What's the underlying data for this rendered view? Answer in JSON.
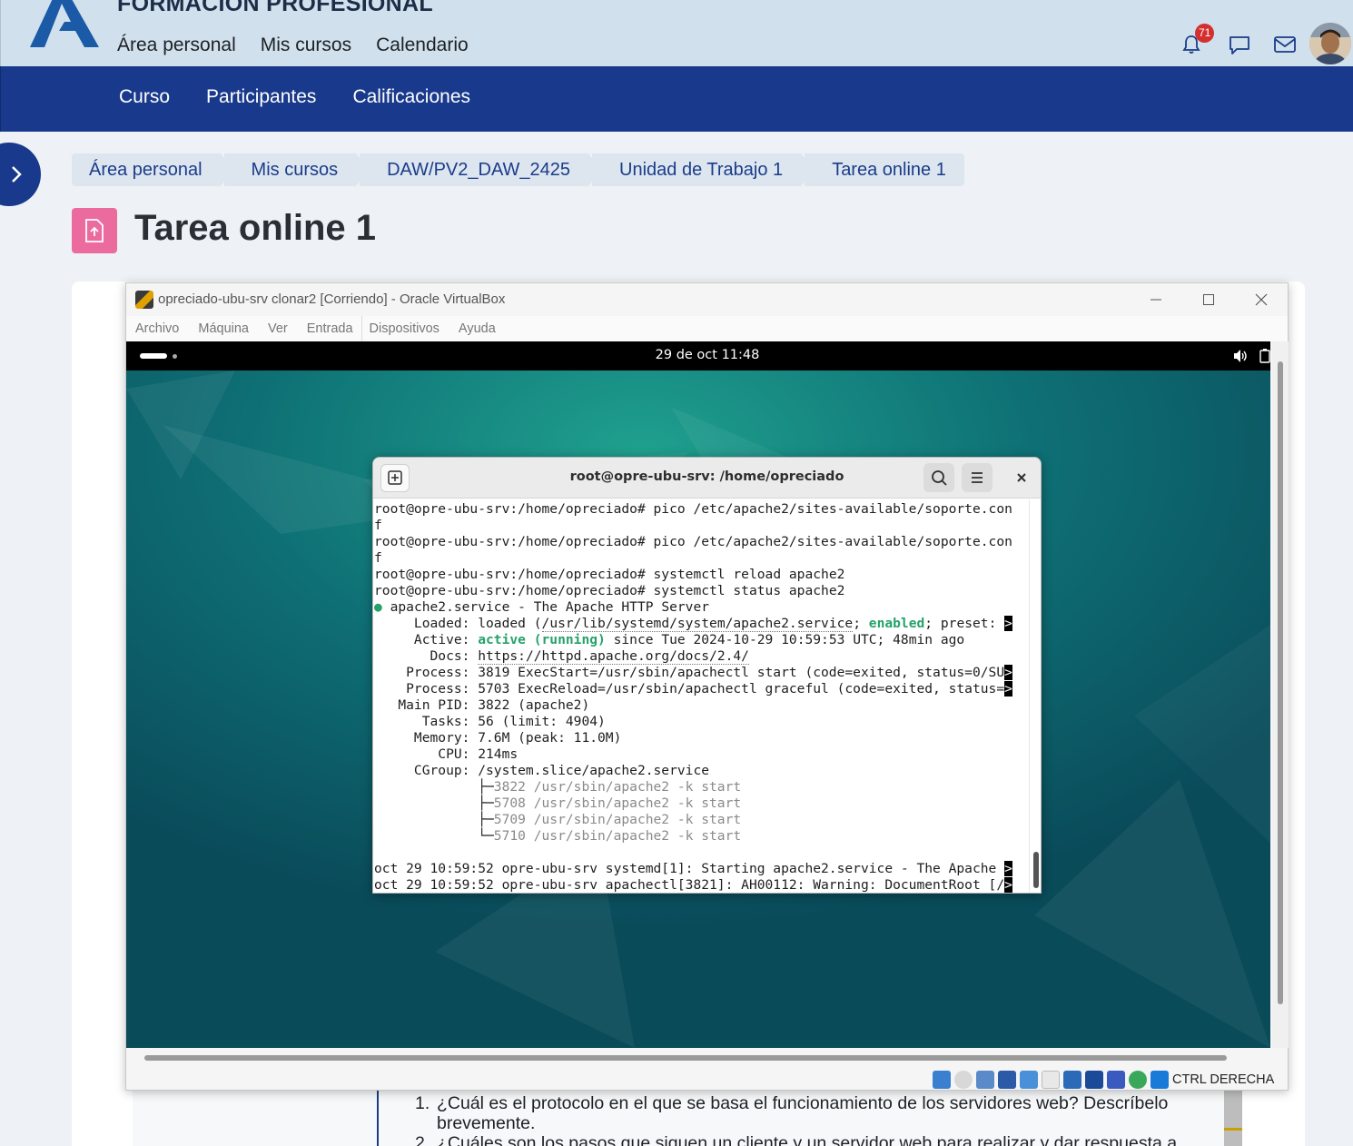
{
  "brand": {
    "name": "FORMACIÓN PROFESIONAL"
  },
  "primary_nav": [
    "Área personal",
    "Mis cursos",
    "Calendario"
  ],
  "notifications": {
    "count": "71"
  },
  "secondary_nav": [
    "Curso",
    "Participantes",
    "Calificaciones"
  ],
  "breadcrumb": [
    "Área personal",
    "Mis cursos",
    "DAW/PV2_DAW_2425",
    "Unidad de Trabajo 1",
    "Tarea online 1"
  ],
  "page": {
    "title": "Tarea online 1"
  },
  "vbox": {
    "title": "opreciado-ubu-srv clonar2 [Corriendo] - Oracle VirtualBox",
    "menu": [
      "Archivo",
      "Máquina",
      "Ver",
      "Entrada",
      "Dispositivos",
      "Ayuda"
    ],
    "host_key": "CTRL DERECHA"
  },
  "vm": {
    "clock": "29 de oct  11:48"
  },
  "terminal": {
    "title": "root@opre-ubu-srv: /home/opreciado",
    "prompt": "root@opre-ubu-srv:/home/opreciado#",
    "cmd1": " pico /etc/apache2/sites-available/soporte.con",
    "cmd1_wrap": "f",
    "cmd2": " systemctl reload apache2",
    "cmd3": " systemctl status apache2",
    "svc_bullet": "●",
    "svc_line": " apache2.service - The Apache HTTP Server",
    "loaded_label": "     Loaded: ",
    "loaded_pre": "loaded (",
    "loaded_path": "/usr/lib/systemd/system/apache2.service",
    "loaded_mid": "; ",
    "loaded_enabled": "enabled",
    "loaded_post": "; preset: ",
    "active_label": "     Active: ",
    "active_state": "active (running)",
    "active_post": " since Tue 2024-10-29 10:59:53 UTC; 48min ago",
    "docs_label": "       Docs: ",
    "docs_url": "https://httpd.apache.org/docs/2.4/",
    "process1": "    Process: 3819 ExecStart=/usr/sbin/apachectl start (code=exited, status=0/SU",
    "process2": "    Process: 5703 ExecReload=/usr/sbin/apachectl graceful (code=exited, status=",
    "mainpid": "   Main PID: 3822 (apache2)",
    "tasks": "      Tasks: 56 (limit: 4904)",
    "memory": "     Memory: 7.6M (peak: 11.0M)",
    "cpu": "        CPU: 214ms",
    "cgroup": "     CGroup: /system.slice/apache2.service",
    "tree_prefix_mid": "             ├─",
    "tree_prefix_last": "             └─",
    "tree1": "3822 /usr/sbin/apache2 -k start",
    "tree2": "5708 /usr/sbin/apache2 -k start",
    "tree3": "5709 /usr/sbin/apache2 -k start",
    "tree4": "5710 /usr/sbin/apache2 -k start",
    "log1": "oct 29 10:59:52 opre-ubu-srv systemd[1]: Starting apache2.service - The Apache ",
    "log2": "oct 29 10:59:52 opre-ubu-srv apachectl[3821]: AH00112: Warning: DocumentRoot [/",
    "overflow_marker": ">"
  },
  "questions": [
    {
      "num": "1.",
      "line1": "¿Cuál es el protocolo en el que se basa el funcionamiento de los servidores web? Descríbelo",
      "line2": "brevemente."
    },
    {
      "num": "2.",
      "line1": "¿Cuáles son los pasos que siguen un cliente y un servidor web para realizar y dar respuesta a"
    }
  ],
  "colors": {
    "nav_blue": "#193a8c",
    "top_bar": "#d0e0ec",
    "accent_pink": "#ec6b9e",
    "terminal_green": "#26a269"
  }
}
